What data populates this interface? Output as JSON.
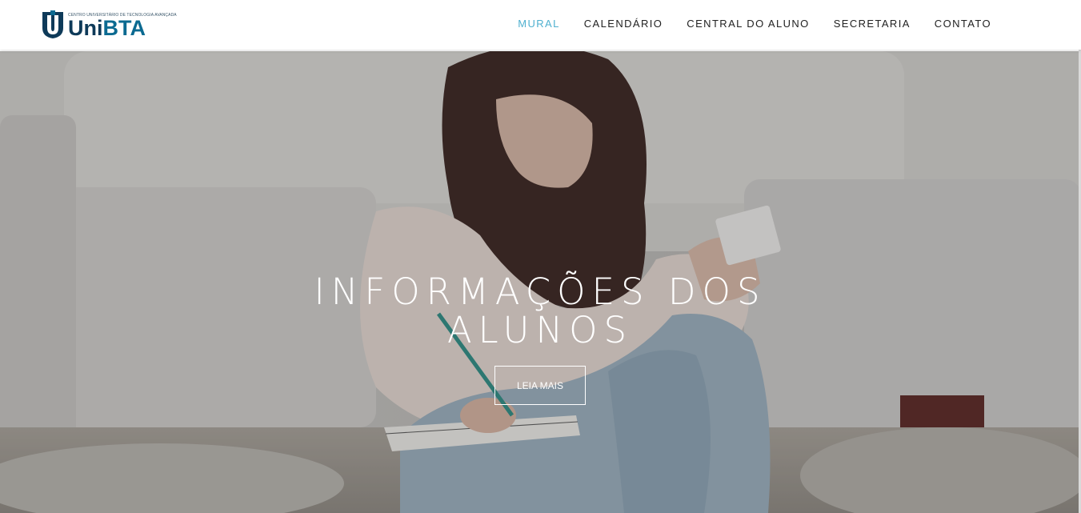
{
  "logo": {
    "tagline": "CENTRO UNIVERSITÁRIO DE TECNOLOGIA AVANÇADA",
    "uni": "Uni",
    "bta": "BTA"
  },
  "nav": {
    "items": [
      {
        "label": "MURAL",
        "active": true
      },
      {
        "label": "CALENDÁRIO",
        "active": false
      },
      {
        "label": "CENTRAL DO ALUNO",
        "active": false
      },
      {
        "label": "SECRETARIA",
        "active": false
      },
      {
        "label": "CONTATO",
        "active": false
      }
    ]
  },
  "hero": {
    "title": "INFORMAÇÕES DOS ALUNOS",
    "button_label": "LEIA MAIS"
  },
  "colors": {
    "accent": "#4fb0cf",
    "brand_dark": "#0e3a59",
    "brand_blue": "#0b6a91"
  }
}
